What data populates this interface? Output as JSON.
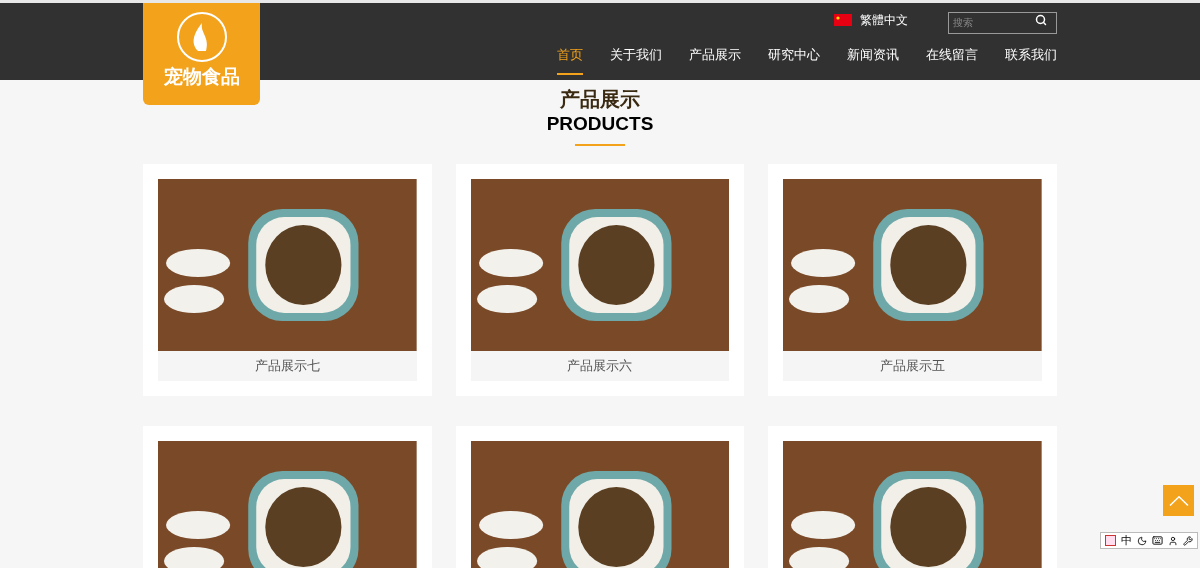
{
  "header": {
    "logo_text": "宠物食品",
    "language": "繁體中文",
    "search": {
      "placeholder": "搜索"
    },
    "nav": [
      {
        "label": "首页",
        "selected": true
      },
      {
        "label": "关于我们",
        "selected": false
      },
      {
        "label": "产品展示",
        "selected": false
      },
      {
        "label": "研究中心",
        "selected": false
      },
      {
        "label": "新闻资讯",
        "selected": false
      },
      {
        "label": "在线留言",
        "selected": false
      },
      {
        "label": "联系我们",
        "selected": false
      }
    ]
  },
  "section": {
    "title": "产品展示",
    "subtitle": "PRODUCTS"
  },
  "products": [
    {
      "kind": "captioned",
      "caption": "产品展示七"
    },
    {
      "kind": "captioned",
      "caption": "产品展示六"
    },
    {
      "kind": "captioned",
      "caption": "产品展示五"
    },
    {
      "kind": "photo-only"
    },
    {
      "kind": "photo-only"
    },
    {
      "kind": "photo-only"
    }
  ],
  "ime_bar": {
    "mode": "中"
  }
}
